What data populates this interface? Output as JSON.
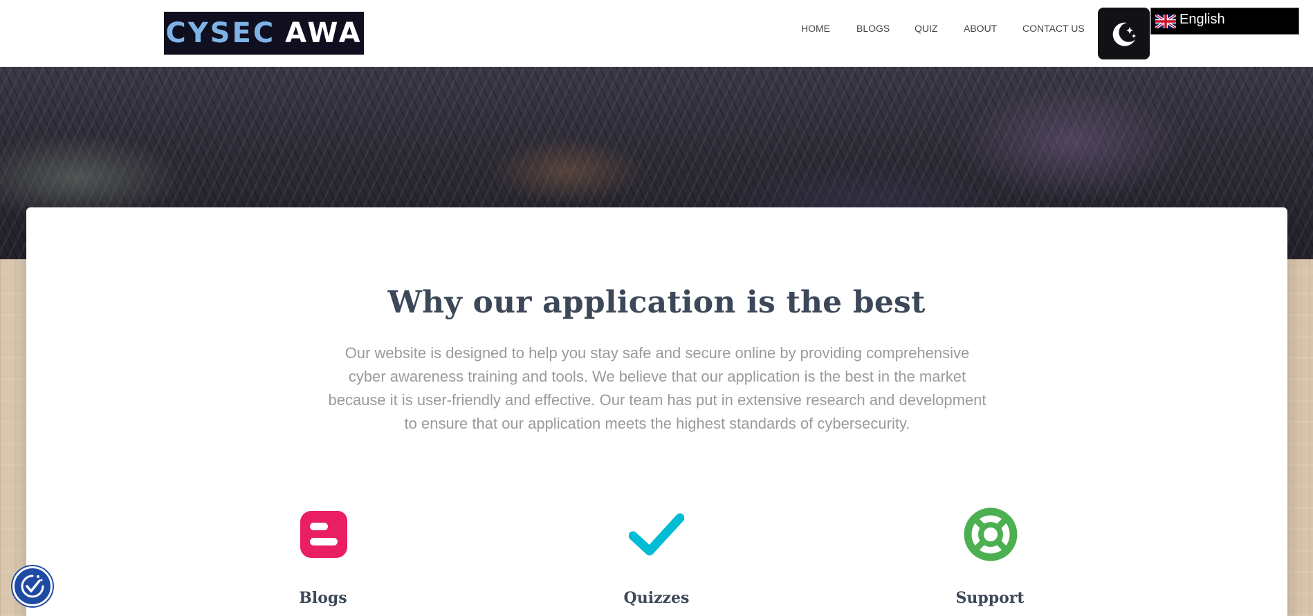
{
  "header": {
    "logo_part1": "CYSEC",
    "logo_part2": "AWA",
    "nav": [
      {
        "label": "HOME"
      },
      {
        "label": "BLOGS"
      },
      {
        "label": "QUIZ"
      },
      {
        "label": "ABOUT"
      },
      {
        "label": "CONTACT US"
      }
    ],
    "language": "English"
  },
  "main": {
    "title": "Why our application is the best",
    "description": "Our website is designed to help you stay safe and secure online by providing comprehensive cyber awareness training and tools. We believe that our application is the best in the market because it is user-friendly and effective. Our team has put in extensive research and development to ensure that our application meets the highest standards of cybersecurity.",
    "features": [
      {
        "label": "Blogs",
        "icon": "blogger-icon",
        "color": "#e91e63"
      },
      {
        "label": "Quizzes",
        "icon": "checkmark-icon",
        "color": "#00bcd4"
      },
      {
        "label": "Support",
        "icon": "lifebuoy-icon",
        "color": "#4caf50"
      }
    ]
  },
  "colors": {
    "header_bg": "#ffffff",
    "logo_accent": "#7fb3e6",
    "heading": "#3c4858",
    "body_text": "#9a9a9a",
    "accessibility_button": "#1f4aa3"
  }
}
